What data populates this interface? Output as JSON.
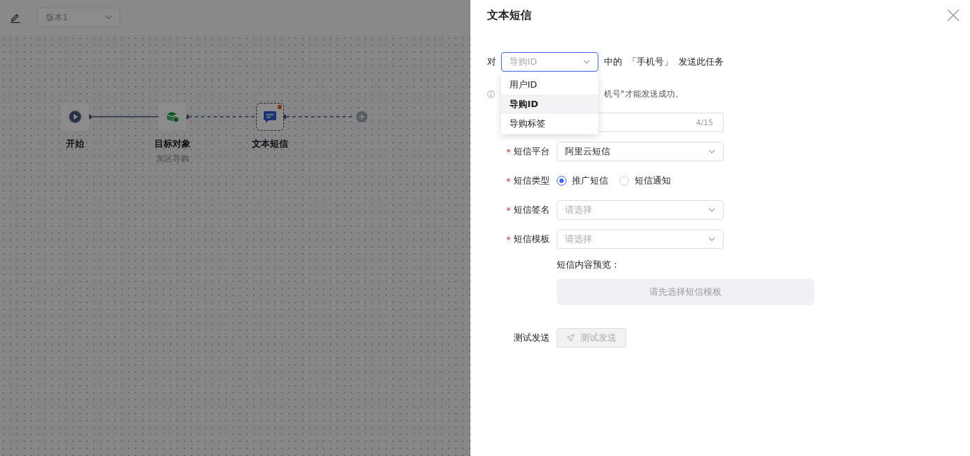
{
  "canvas": {
    "version_select": {
      "value": "版本1"
    },
    "nodes": [
      {
        "kind": "start",
        "label": "开始",
        "connector_dashed": false
      },
      {
        "kind": "audience",
        "label": "目标对象",
        "subtitle": "东区导购",
        "connector_dashed": true
      },
      {
        "kind": "sms",
        "label": "文本短信",
        "selected": true,
        "alert": true,
        "connector_dashed": true
      }
    ]
  },
  "drawer": {
    "title": "文本短信",
    "target_row": {
      "prefix": "对",
      "select": {
        "value": "导购ID",
        "open": true,
        "options": [
          {
            "label": "用户ID",
            "selected": false
          },
          {
            "label": "导购ID",
            "selected": true
          },
          {
            "label": "导购标签",
            "selected": false
          }
        ]
      },
      "middle": "中的",
      "field": "「手机号」",
      "suffix": "发送此任务"
    },
    "info": {
      "text": "机号\"才能发送成功。"
    },
    "name_field": {
      "counter": "4/15"
    },
    "fields": [
      {
        "kind": "select",
        "label": "短信平台",
        "required_mark": "*",
        "value": "阿里云短信"
      },
      {
        "kind": "radio",
        "label": "短信类型",
        "required_mark": "*",
        "options": [
          {
            "label": "推广短信",
            "selected": true
          },
          {
            "label": "短信通知",
            "selected": false
          }
        ]
      },
      {
        "kind": "select",
        "label": "短信签名",
        "required_mark": "*",
        "placeholder": "请选择"
      },
      {
        "kind": "select",
        "label": "短信模板",
        "required_mark": "*",
        "placeholder": "请选择"
      }
    ],
    "preview": {
      "label": "短信内容预览：",
      "placeholder": "请先选择短信模板"
    },
    "test": {
      "label": "测试发送",
      "button": {
        "label": "测试发送",
        "disabled": true
      }
    }
  }
}
